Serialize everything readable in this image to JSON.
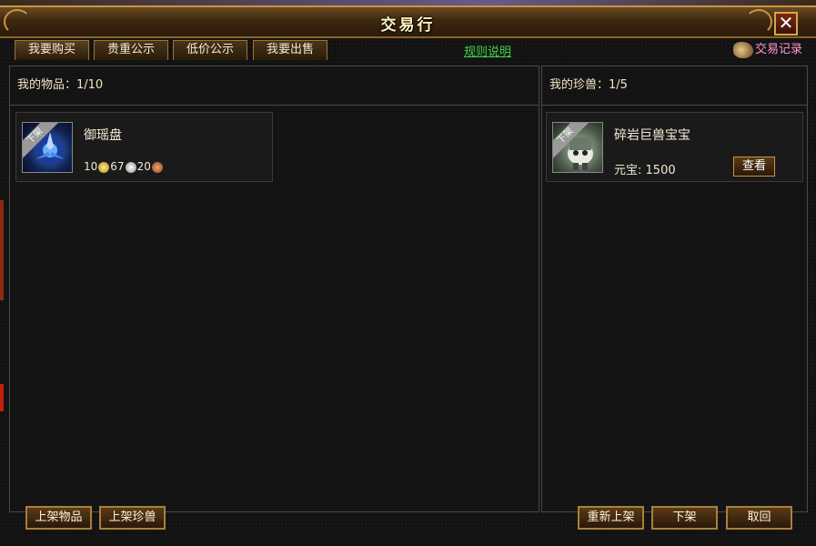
{
  "window": {
    "title": "交易行",
    "close_label": "✕"
  },
  "tabs": [
    {
      "label": "我要购买"
    },
    {
      "label": "贵重公示"
    },
    {
      "label": "低价公示"
    },
    {
      "label": "我要出售"
    }
  ],
  "rules_link": "规则说明",
  "trade_log": "交易记录",
  "items_panel": {
    "header": "我的物品：1/10",
    "items": [
      {
        "badge": "下架",
        "name": "御瑶盘",
        "price": {
          "gold": "10",
          "silver": "67",
          "copper": "20"
        }
      }
    ]
  },
  "pets_panel": {
    "header": "我的珍兽：1/5",
    "pets": [
      {
        "badge": "下架",
        "name": "碎岩巨兽宝宝",
        "price_label": "元宝:",
        "price_value": "1500",
        "view_button": "查看"
      }
    ]
  },
  "bottom_buttons": {
    "list_item": "上架物品",
    "list_pet": "上架珍兽",
    "relist": "重新上架",
    "delist": "下架",
    "cancel": "取回"
  }
}
